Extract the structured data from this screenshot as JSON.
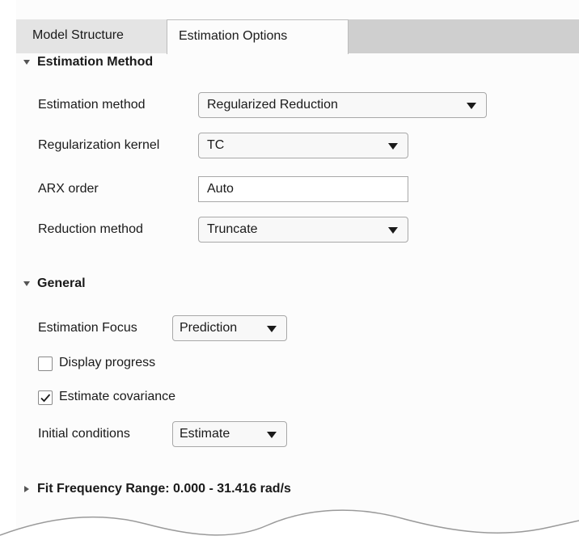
{
  "tabs": [
    {
      "label": "Model Structure",
      "active": false
    },
    {
      "label": "Estimation Options",
      "active": true
    }
  ],
  "estimation_method_section": {
    "title": "Estimation Method",
    "expanded": true,
    "fields": {
      "estimation_method": {
        "label": "Estimation method",
        "value": "Regularized Reduction"
      },
      "regularization_kernel": {
        "label": "Regularization kernel",
        "value": "TC"
      },
      "arx_order": {
        "label": "ARX order",
        "value": "Auto"
      },
      "reduction_method": {
        "label": "Reduction method",
        "value": "Truncate"
      }
    }
  },
  "general_section": {
    "title": "General",
    "expanded": true,
    "estimation_focus": {
      "label": "Estimation Focus",
      "value": "Prediction"
    },
    "display_progress": {
      "label": "Display progress",
      "checked": false
    },
    "estimate_covariance": {
      "label": "Estimate covariance",
      "checked": true
    },
    "initial_conditions": {
      "label": "Initial conditions",
      "value": "Estimate"
    }
  },
  "fit_frequency_section": {
    "title": "Fit Frequency Range: 0.000 - 31.416 rad/s",
    "expanded": false
  },
  "icons": {
    "expanded": "triangle-down-icon",
    "collapsed": "triangle-right-icon",
    "dropdown": "chevron-down-icon",
    "check": "checkmark-icon"
  },
  "colors": {
    "tab_bar": "#cfcfcf",
    "inactive_tab": "#e4e4e4",
    "panel": "#fcfcfc",
    "control_border": "#a8a8a8"
  }
}
